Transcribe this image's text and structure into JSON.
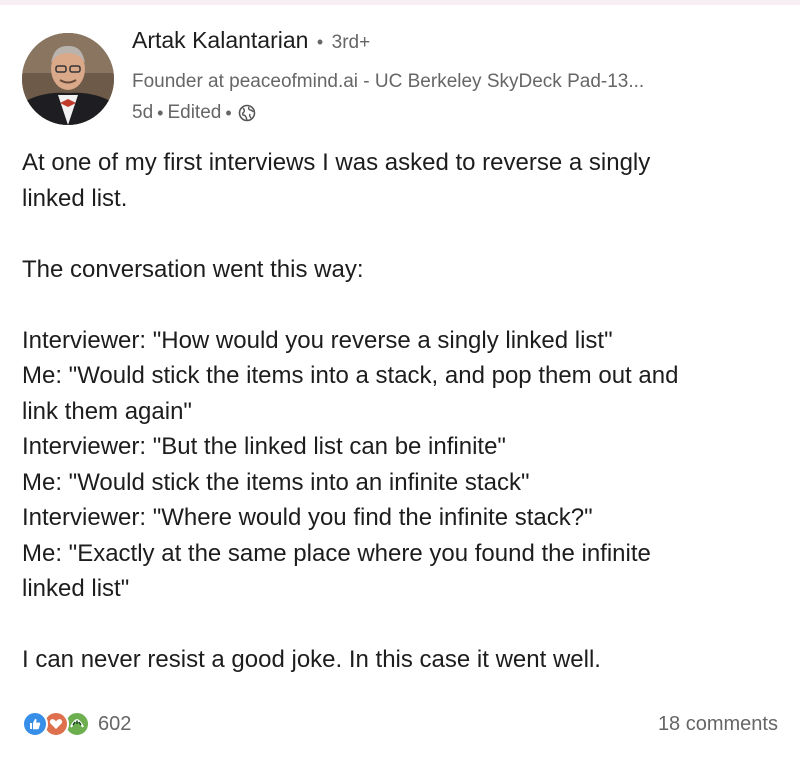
{
  "post": {
    "author": {
      "name": "Artak Kalantarian",
      "separator": "•",
      "degree": "3rd+",
      "headline": "Founder at peaceofmind.ai - UC Berkeley SkyDeck Pad-13...",
      "time": "5d",
      "edited": "Edited",
      "visibility_icon": "globe-icon"
    },
    "paragraphs": [
      "At one of my first interviews I was asked to reverse a singly linked list.",
      "The conversation went this way:",
      "Interviewer: \"How would you reverse a singly linked list\"\nMe: \"Would stick the items into a stack, and pop them out and link them again\"\nInterviewer:  \"But the linked list can be infinite\"\nMe: \"Would stick the items into an infinite stack\"\nInterviewer:  \"Where would you find the infinite stack?\"\nMe: \"Exactly at the same place where you found the infinite linked list\"",
      "I can never resist a good joke. In this case it went well."
    ],
    "lines": {
      "p1a": "At one of my first interviews I was asked to reverse a singly",
      "p1b": "linked list.",
      "p2": "The conversation went this way:",
      "l1": "Interviewer: \"How would you reverse a singly linked list\"",
      "l2a": "Me: \"Would stick the items into a stack, and pop them out and",
      "l2b": "link them again\"",
      "l3": "Interviewer:  \"But the linked list can be infinite\"",
      "l4": "Me: \"Would stick the items into an infinite stack\"",
      "l5": "Interviewer:  \"Where would you find the infinite stack?\"",
      "l6a": "Me: \"Exactly at the same place where you found the infinite",
      "l6b": "linked list\"",
      "p4": "I can never resist a good joke. In this case it went well."
    },
    "reactions": {
      "icons": [
        "like-icon",
        "love-icon",
        "support-icon"
      ],
      "colors": {
        "like": "#378fe9",
        "love": "#df704d",
        "support": "#6dae4f"
      },
      "count": "602"
    },
    "comments": "18 comments"
  }
}
